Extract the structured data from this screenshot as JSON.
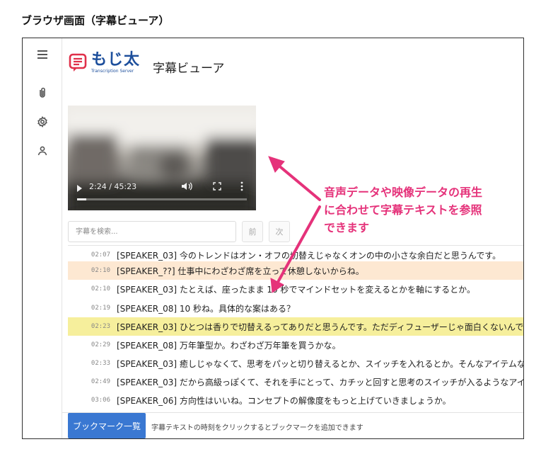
{
  "caption": "ブラウザ画面（字幕ビューア）",
  "brand": {
    "name": "もじ太",
    "tagline": "Transcription Server"
  },
  "page_title": "字幕ビューア",
  "sidebar": {
    "items": [
      {
        "name": "menu-icon"
      },
      {
        "name": "paperclip-icon"
      },
      {
        "name": "settings-icon"
      },
      {
        "name": "user-icon"
      }
    ]
  },
  "video": {
    "time": "2:24 / 45:23",
    "progress": 0.053
  },
  "search": {
    "placeholder": "字幕を検索...",
    "prev_label": "前",
    "next_label": "次"
  },
  "subtitles": [
    {
      "time": "02:07",
      "text": "[SPEAKER_03] 今のトレンドはオン・オフの切替えじゃなくオンの中の小さな余白だと思うんです。",
      "highlight": ""
    },
    {
      "time": "02:10",
      "text": "[SPEAKER_??] 仕事中にわざわざ席を立って休憩しないからね。",
      "highlight": "orange"
    },
    {
      "time": "02:10",
      "text": "[SPEAKER_03] たとえば、座ったまま 10 秒でマインドセットを変えるとかを軸にするとか。",
      "highlight": ""
    },
    {
      "time": "02:19",
      "text": "[SPEAKER_08] 10 秒ね。具体的な案はある？",
      "highlight": ""
    },
    {
      "time": "02:23",
      "text": "[SPEAKER_03] ひとつは香りで切替えるってありだと思うんです。ただディフューザーじゃ面白くないんです",
      "highlight": "yellow"
    },
    {
      "time": "02:29",
      "text": "[SPEAKER_08] 万年筆型か。わざわざ万年筆を買うかな。",
      "highlight": ""
    },
    {
      "time": "02:33",
      "text": "[SPEAKER_03] 癒しじゃなくて、思考をパッと切り替えるとか、スイッチを入れるとか。そんなアイテムなん",
      "highlight": ""
    },
    {
      "time": "02:49",
      "text": "[SPEAKER_03] だから高級っぽくて、それを手にとって、カチッと回すと思考のスイッチが入るようなアイテ",
      "highlight": ""
    },
    {
      "time": "03:06",
      "text": "[SPEAKER_06] 方向性はいいね。コンセプトの解像度をもっと上げていきましょうか。",
      "highlight": ""
    }
  ],
  "footer": {
    "bookmark_button": "ブックマーク一覧",
    "hint": "字幕テキストの時刻をクリックするとブックマークを追加できます"
  },
  "annotation": {
    "lines": [
      "音声データや映像データの再生",
      "に合わせて字幕テキストを参照",
      "できます"
    ]
  },
  "colors": {
    "accent": "#3a78d2",
    "brand": "#1d4f9c",
    "logo_red": "#e0304a",
    "annotation": "#e5327a",
    "highlight_orange": "#fde8d2",
    "highlight_yellow": "#f6ef9c"
  }
}
